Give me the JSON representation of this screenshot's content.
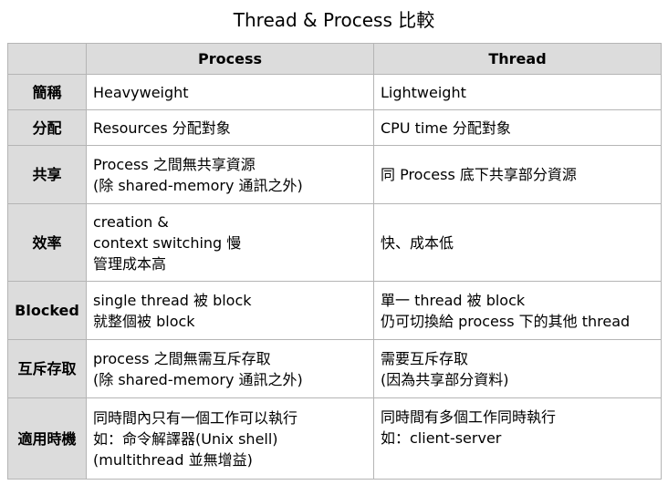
{
  "title": "Thread & Process 比較",
  "table": {
    "columns": [
      "",
      "Process",
      "Thread"
    ],
    "rows": [
      {
        "label": "簡稱",
        "process": [
          "Heavyweight"
        ],
        "thread": [
          "Lightweight"
        ]
      },
      {
        "label": "分配",
        "process": [
          "Resources 分配對象"
        ],
        "thread": [
          "CPU time 分配對象"
        ]
      },
      {
        "label": "共享",
        "process": [
          "Process 之間無共享資源",
          "(除 shared-memory 通訊之外)"
        ],
        "thread": [
          "同 Process 底下共享部分資源"
        ]
      },
      {
        "label": "效率",
        "process": [
          "creation &",
          "context switching 慢",
          "管理成本高"
        ],
        "thread": [
          "快、成本低"
        ]
      },
      {
        "label": "Blocked",
        "process": [
          "single thread 被 block",
          "就整個被 block"
        ],
        "thread": [
          "單一 thread 被 block",
          "仍可切換給 process 下的其他 thread"
        ]
      },
      {
        "label": "互斥存取",
        "process": [
          "process 之間無需互斥存取",
          "(除 shared-memory 通訊之外)"
        ],
        "thread": [
          "需要互斥存取",
          "(因為共享部分資料)"
        ]
      },
      {
        "label": "適用時機",
        "process": [
          "同時間內只有一個工作可以執行",
          "如：命令解譯器(Unix shell)",
          "(multithread 並無增益)"
        ],
        "thread": [
          "同時間有多個工作同時執行",
          "如：client-server"
        ]
      }
    ]
  }
}
